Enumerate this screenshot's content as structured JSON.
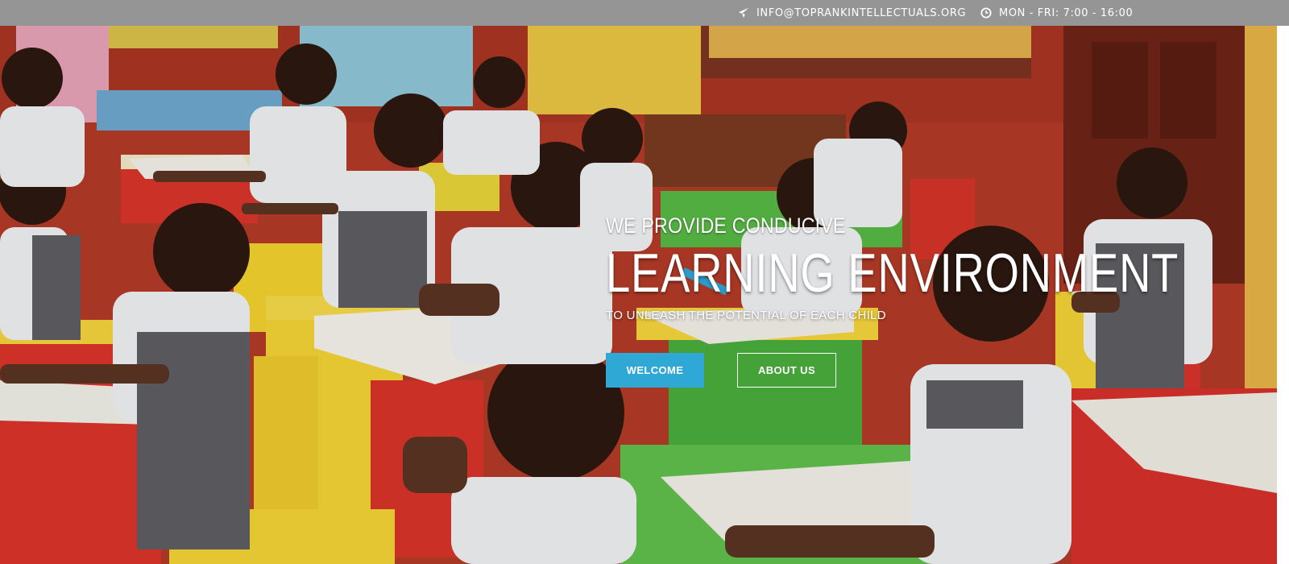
{
  "topbar": {
    "email": "INFO@TOPRANKINTELLECTUALS.ORG",
    "hours": "MON - FRI: 7:00 - 16:00",
    "email_icon": "paper-plane-icon",
    "hours_icon": "clock-icon"
  },
  "hero": {
    "kicker": "WE PROVIDE CONDUCIVE",
    "headline": "LEARNING ENVIRONMENT",
    "subline": "TO UNLEASH THE POTENTIAL OF EACH CHILD",
    "buttons": {
      "welcome": "WELCOME",
      "about": "ABOUT US"
    },
    "colors": {
      "topbar": "#959595",
      "welcome_button": "#2fa8d6",
      "wall": "#b23a26"
    }
  }
}
